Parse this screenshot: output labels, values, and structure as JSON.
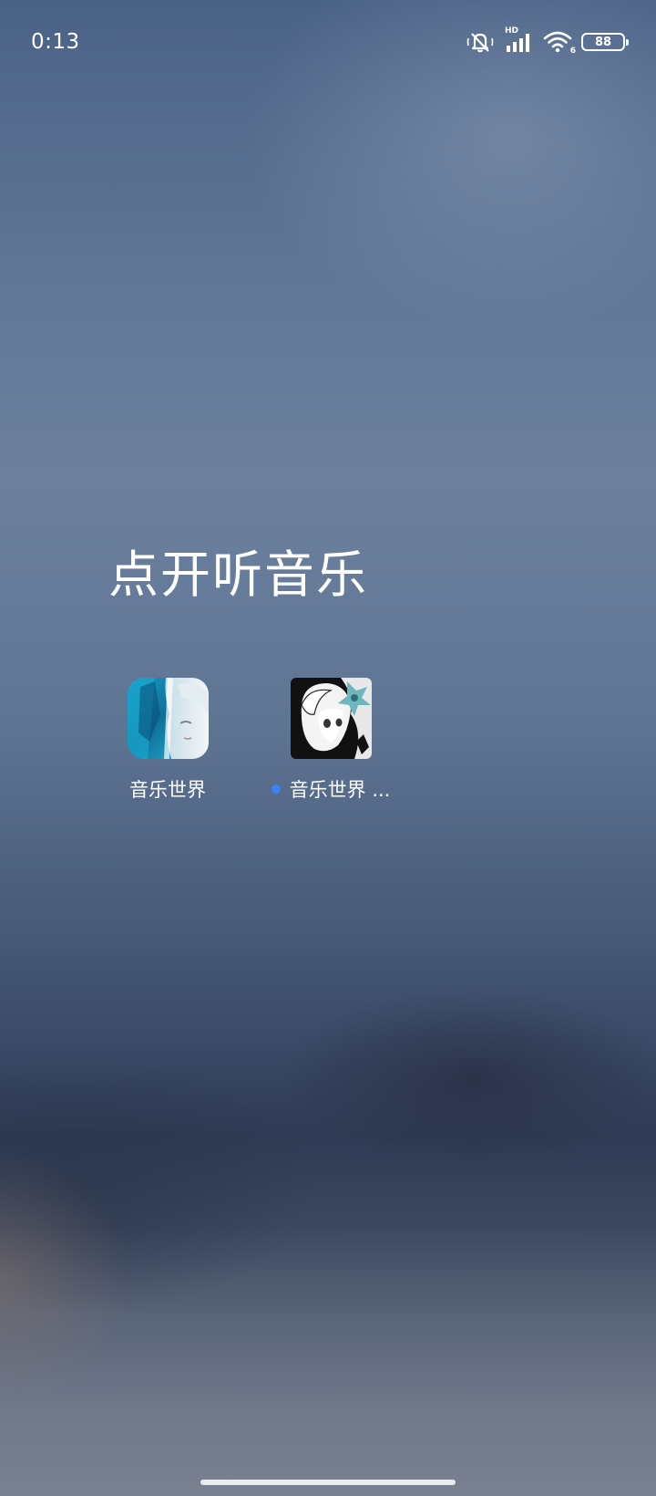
{
  "status_bar": {
    "time": "0:13",
    "signal_label": "HD",
    "wifi_badge": "6",
    "battery": "88"
  },
  "folder": {
    "title": "点开听音乐",
    "apps": [
      {
        "label": "音乐世界",
        "icon": "crystal-girl-app-icon",
        "new": false
      },
      {
        "label": "音乐世界 ...",
        "icon": "anime-girl-app-icon",
        "new": true
      }
    ]
  },
  "colors": {
    "new_dot": "#3b82f6",
    "text": "#ffffff"
  }
}
